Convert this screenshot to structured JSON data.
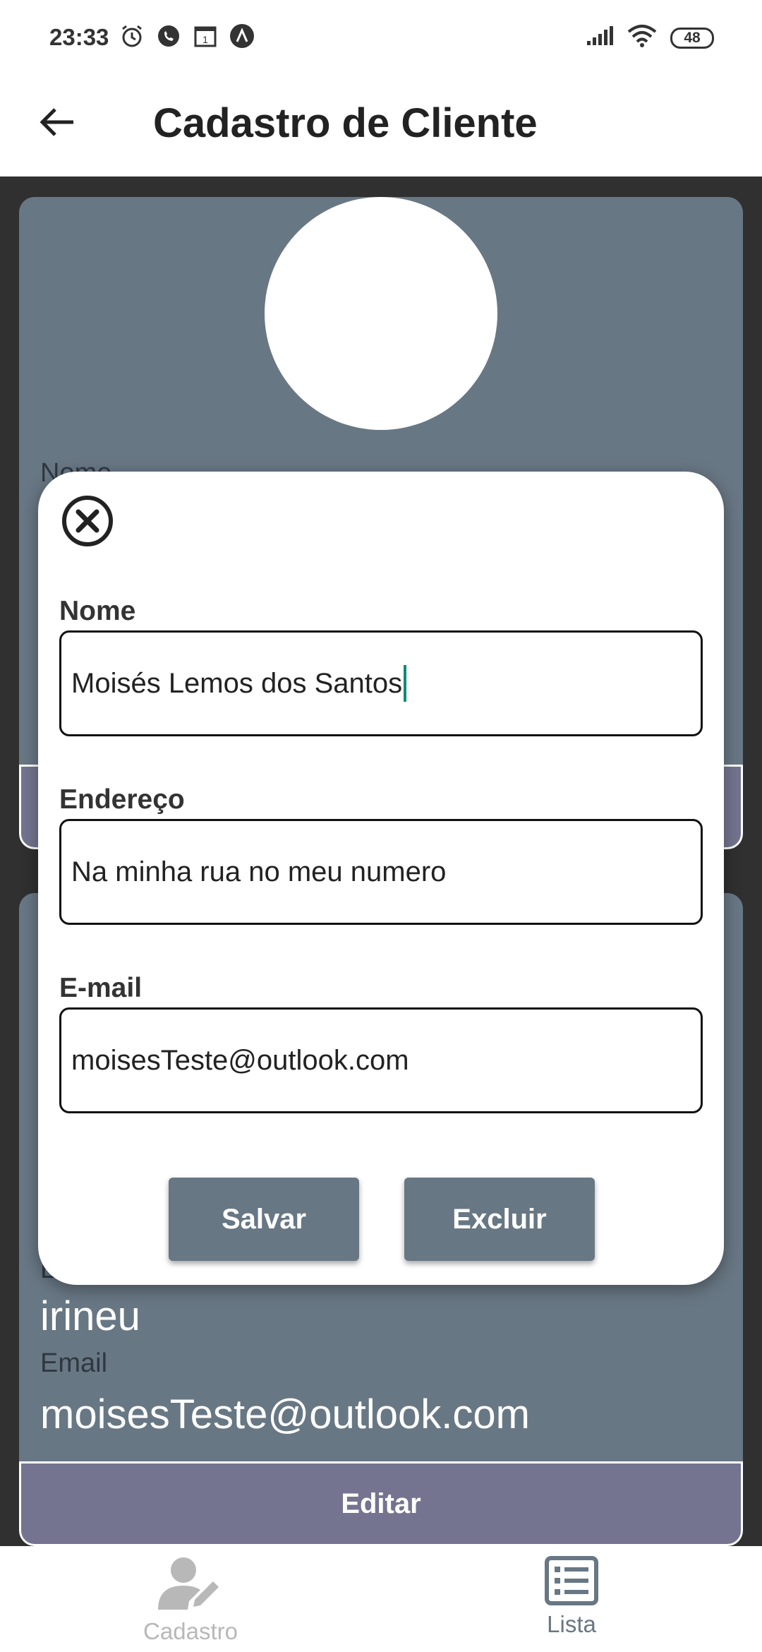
{
  "status_bar": {
    "time": "23:33",
    "battery": "48",
    "icons_left": [
      "alarm-icon",
      "whatsapp-icon",
      "calendar-icon",
      "app-icon"
    ],
    "icons_right": [
      "signal-icon",
      "wifi-icon",
      "battery-icon"
    ]
  },
  "app_bar": {
    "title": "Cadastro de Cliente",
    "back_icon": "arrow-left-icon"
  },
  "background_cards": {
    "card1": {
      "partial_label": "Nome"
    },
    "card2": {
      "partial_label": "E",
      "address_value": "irineu",
      "email_label": "Email",
      "email_value": "moisesTeste@outlook.com",
      "edit_button": "Editar"
    }
  },
  "modal": {
    "close_icon": "close-circle-icon",
    "fields": [
      {
        "label": "Nome",
        "value": "Moisés Lemos dos Santos"
      },
      {
        "label": "Endereço",
        "value": "Na minha rua no meu numero"
      },
      {
        "label": "E-mail",
        "value": "moisesTeste@outlook.com"
      }
    ],
    "save_button": "Salvar",
    "delete_button": "Excluir"
  },
  "bottom_nav": {
    "items": [
      {
        "label": "Cadastro",
        "icon": "user-edit-icon",
        "active": false
      },
      {
        "label": "Lista",
        "icon": "list-icon",
        "active": true
      }
    ]
  },
  "colors": {
    "card_bg": "#687784",
    "edit_button_bg": "#747490",
    "dark_bg": "#303030",
    "caret": "#0a8a7a",
    "inactive_nav": "#b8b8b8",
    "active_nav": "#687784"
  }
}
